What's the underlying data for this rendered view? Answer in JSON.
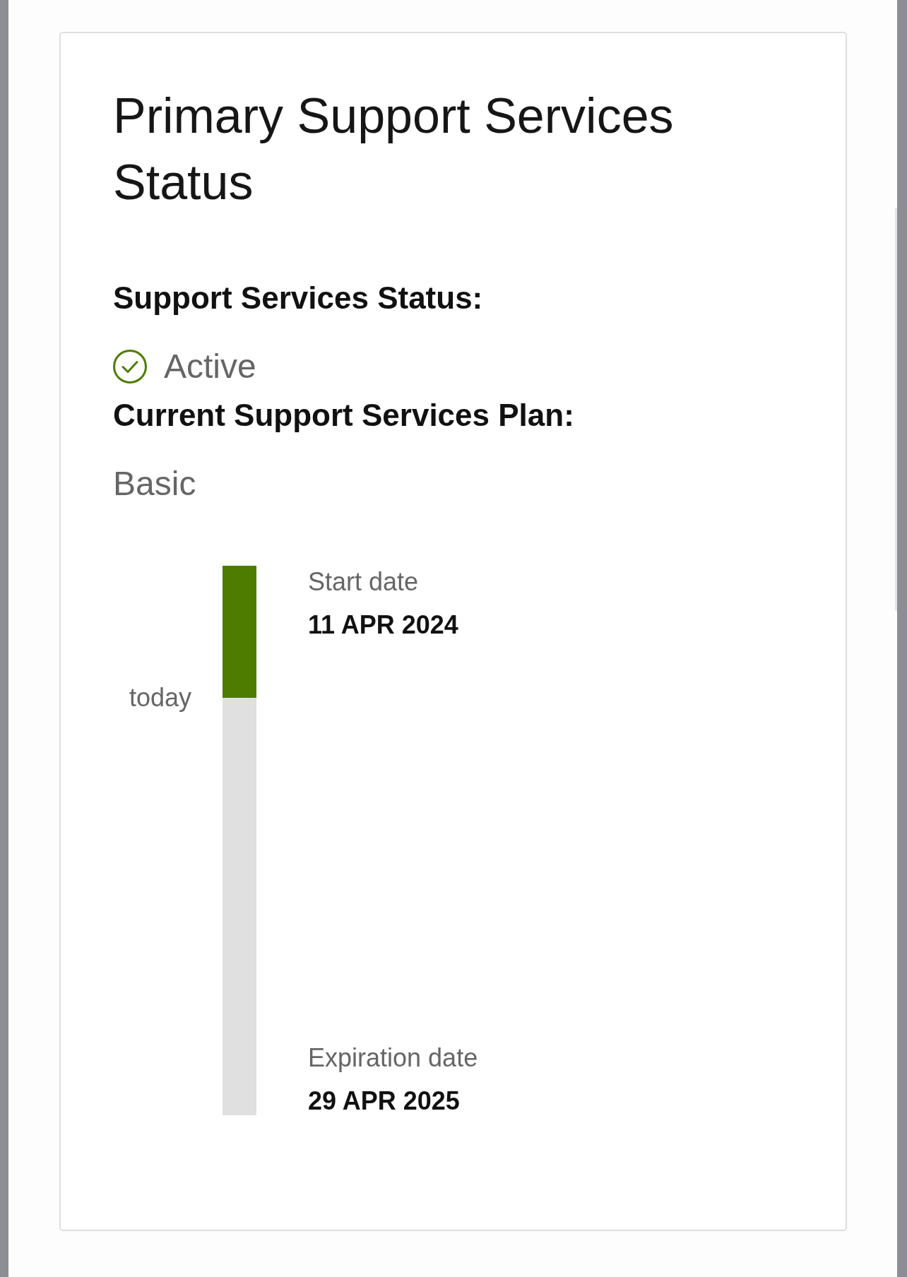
{
  "title": "Primary Support Services Status",
  "status": {
    "label": "Support Services Status:",
    "active": true,
    "value": "Active"
  },
  "plan": {
    "label": "Current Support Services Plan:",
    "value": "Basic"
  },
  "timeline": {
    "marker": "today",
    "level": 0.24,
    "start": {
      "label": "Start date",
      "value": "11 APR 2024"
    },
    "end": {
      "label": "Expiration date",
      "value": "29 APR 2025"
    }
  }
}
